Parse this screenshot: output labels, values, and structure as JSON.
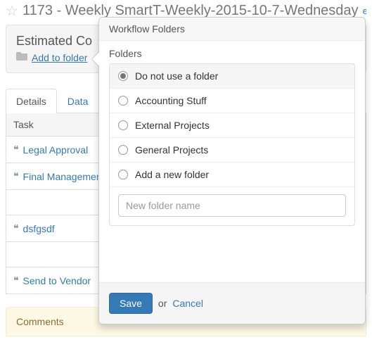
{
  "header": {
    "title": "1173 - Weekly SmartT-Weekly-2015-10-7-Wednesday",
    "edit": "edit"
  },
  "panel": {
    "title": "Estimated Co",
    "addToFolder": "Add to folder"
  },
  "tabs": {
    "details": "Details",
    "data": "Data"
  },
  "taskHeader": "Task",
  "tasks": [
    "Legal Approval",
    "Final Management",
    "dsfgsdf",
    "Send to Vendor"
  ],
  "comments": "Comments",
  "popover": {
    "title": "Workflow Folders",
    "foldersLabel": "Folders",
    "options": [
      "Do not use a folder",
      "Accounting Stuff",
      "External Projects",
      "General Projects",
      "Add a new folder"
    ],
    "placeholder": "New folder name",
    "save": "Save",
    "or": "or",
    "cancel": "Cancel"
  }
}
